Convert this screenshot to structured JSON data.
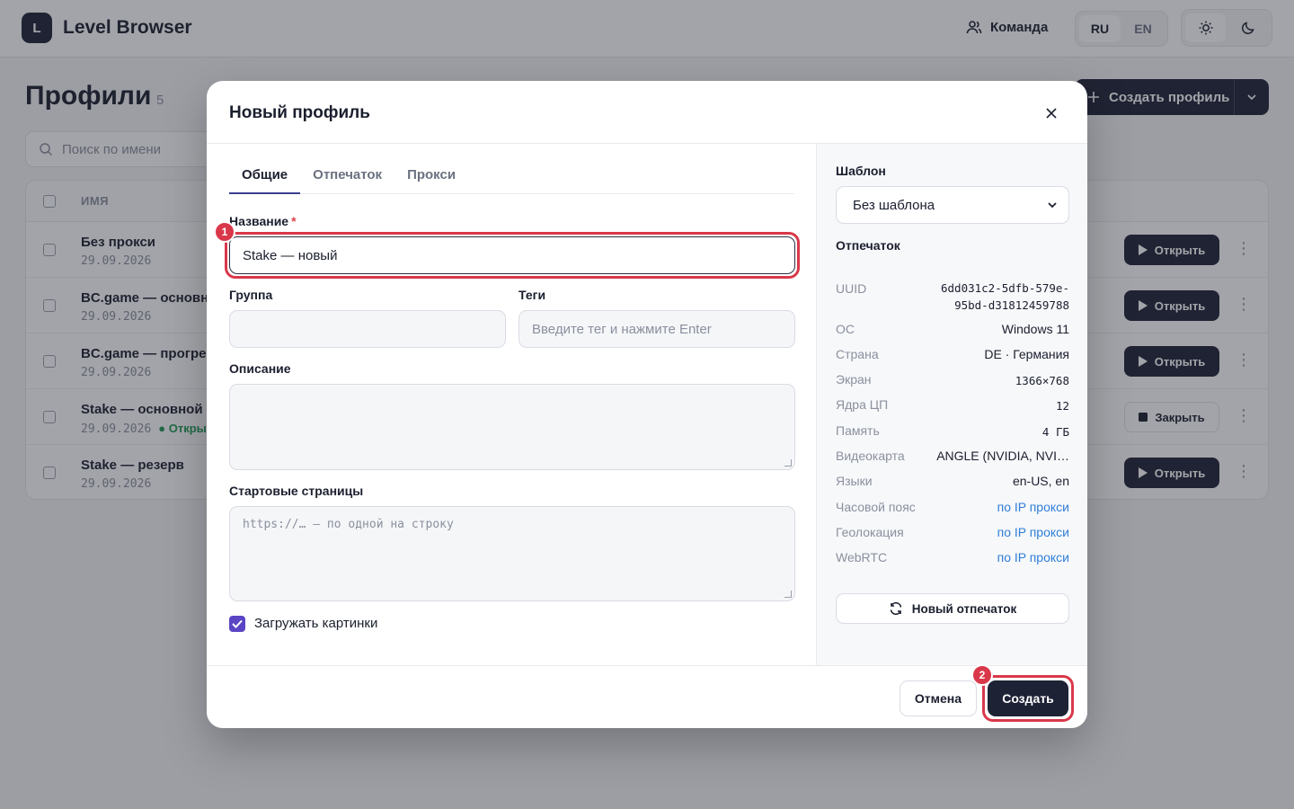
{
  "app": {
    "logo_letter": "L",
    "title": "Level Browser"
  },
  "topbar": {
    "team_label": "Команда",
    "languages": [
      "RU",
      "EN"
    ],
    "active_language": "RU",
    "theme_modes": [
      "sun-icon",
      "moon-icon"
    ]
  },
  "page": {
    "title": "Профили",
    "count": "5",
    "create_button": "Создать профиль",
    "search_placeholder": "Поиск по имени",
    "column_name": "ИМЯ",
    "rows": [
      {
        "name": "Без прокси",
        "date": "29.09.2026",
        "status": "",
        "action": "Открыть"
      },
      {
        "name": "BC.game — основной",
        "date": "29.09.2026",
        "status": "",
        "action": "Открыть"
      },
      {
        "name": "BC.game — прогрев",
        "date": "29.09.2026",
        "status": "",
        "action": "Открыть"
      },
      {
        "name": "Stake — основной",
        "date": "29.09.2026",
        "status": "Открыт",
        "action": "Закрыть"
      },
      {
        "name": "Stake — резерв",
        "date": "29.09.2026",
        "status": "",
        "action": "Открыть"
      }
    ]
  },
  "modal": {
    "title": "Новый профиль",
    "tabs": [
      "Общие",
      "Отпечаток",
      "Прокси"
    ],
    "active_tab": "Общие",
    "name_label": "Название",
    "name_required": "*",
    "name_value": "Stake — новый",
    "group_label": "Группа",
    "group_value": "",
    "tags_label": "Теги",
    "tags_placeholder": "Введите тег и нажмите Enter",
    "description_label": "Описание",
    "description_value": "",
    "start_pages_label": "Стартовые страницы",
    "start_pages_placeholder": "https://… — по одной на строку",
    "load_images_label": "Загружать картинки",
    "load_images_checked": true,
    "template_label": "Шаблон",
    "template_value": "Без шаблона",
    "fingerprint_label": "Отпечаток",
    "fingerprint": {
      "uuid_key": "UUID",
      "uuid_line1": "6dd031c2-5dfb-579e-",
      "uuid_line2": "95bd-d31812459788",
      "os_key": "ОС",
      "os_val": "Windows 11",
      "country_key": "Страна",
      "country_val": "DE · Германия",
      "screen_key": "Экран",
      "screen_val": "1366×768",
      "cpu_key": "Ядра ЦП",
      "cpu_val": "12",
      "memory_key": "Память",
      "memory_val": "4 ГБ",
      "gpu_key": "Видеокарта",
      "gpu_val": "ANGLE (NVIDIA, NVI…",
      "lang_key": "Языки",
      "lang_val": "en-US, en",
      "tz_key": "Часовой пояс",
      "tz_val": "по IP прокси",
      "geo_key": "Геолокация",
      "geo_val": "по IP прокси",
      "webrtc_key": "WebRTC",
      "webrtc_val": "по IP прокси"
    },
    "new_fingerprint_button": "Новый отпечаток",
    "cancel_button": "Отмена",
    "create_button": "Создать",
    "step_badges": [
      "1",
      "2"
    ]
  },
  "colors": {
    "accent": "#1e2235",
    "highlight": "#d9384a",
    "link": "#2f7ed8",
    "checkbox": "#5b45c4",
    "status_open": "#1f9a55"
  }
}
